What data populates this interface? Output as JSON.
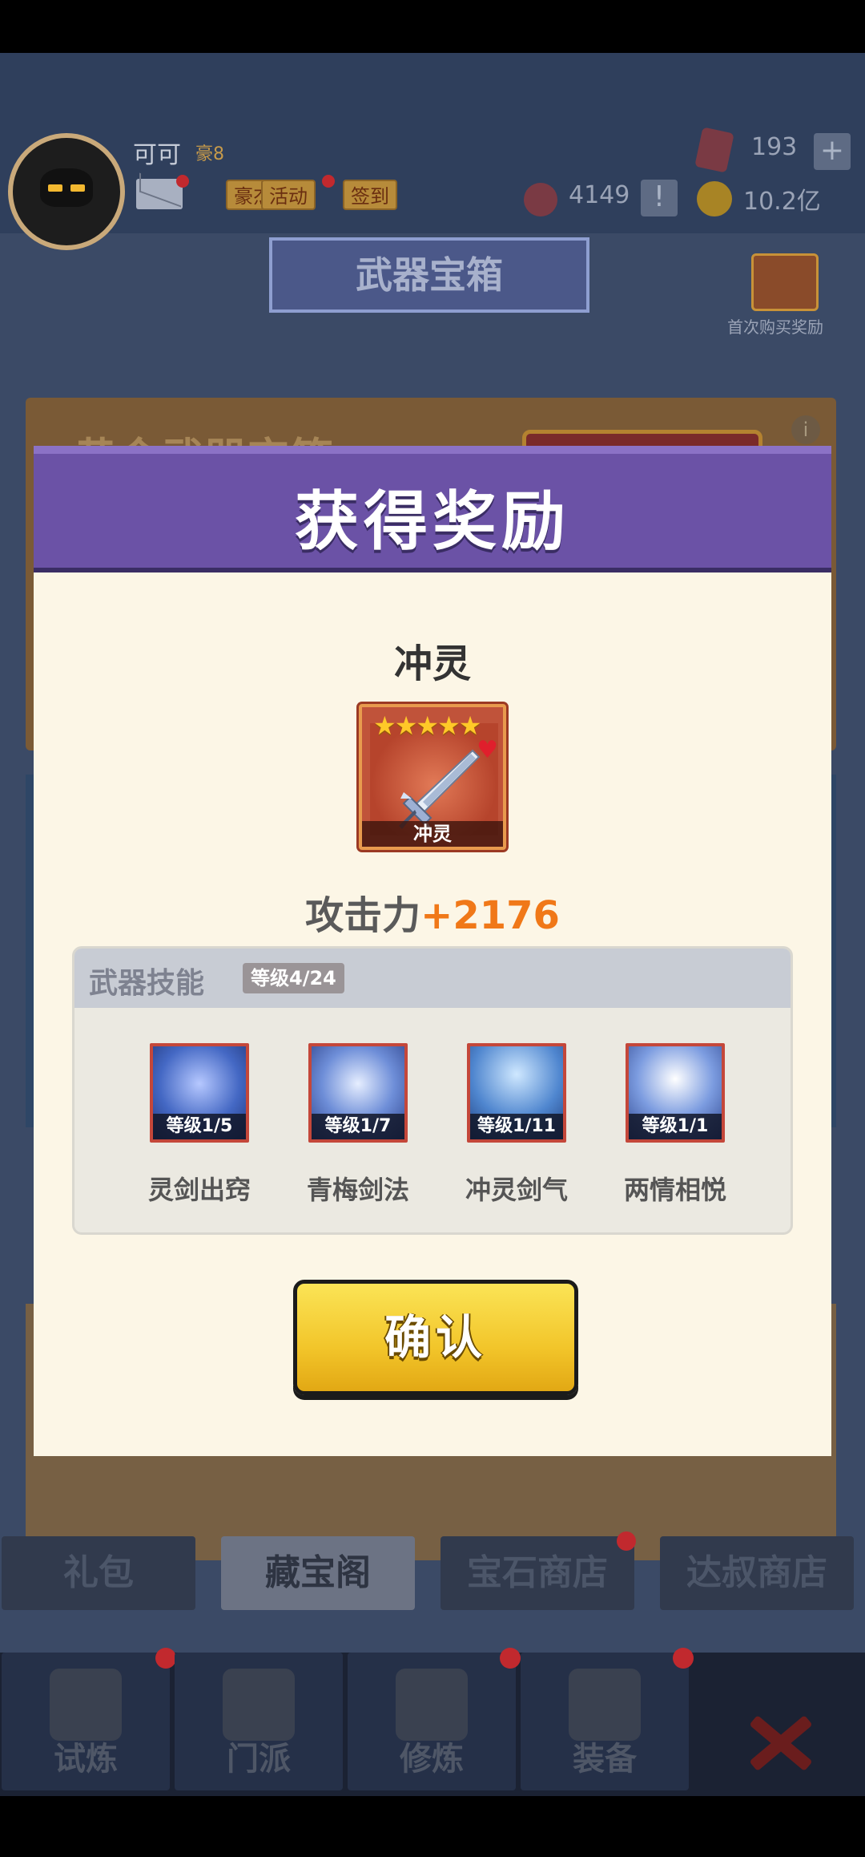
{
  "player": {
    "name": "可可",
    "vip": "豪8",
    "tags": [
      "豪杰",
      "活动",
      "签到"
    ]
  },
  "resources": {
    "gems": "193",
    "tokens": "4149",
    "gold": "10.2亿"
  },
  "page_title": "武器宝箱",
  "first_purchase_reward": "首次购买奖励",
  "gold_chest_title": "黄金武器宝箱",
  "shop_tabs": [
    "礼包",
    "藏宝阁",
    "宝石商店",
    "达叔商店"
  ],
  "bottom_nav": [
    "试炼",
    "门派",
    "修炼",
    "装备"
  ],
  "modal": {
    "title": "获得奖励",
    "weapon_name": "冲灵",
    "weapon_card_label": "冲灵",
    "stars": "★★★★★",
    "star_count": 5,
    "attack_label": "攻击力",
    "attack_value": "+2176",
    "skills_title": "武器技能",
    "skills_level": "等级4/24",
    "skills": [
      {
        "name": "灵剑出窍",
        "level": "等级1/5"
      },
      {
        "name": "青梅剑法",
        "level": "等级1/7"
      },
      {
        "name": "冲灵剑气",
        "level": "等级1/11"
      },
      {
        "name": "两情相悦",
        "level": "等级1/1"
      }
    ],
    "confirm_label": "确认"
  },
  "colors": {
    "header_purple": "#6b52a6",
    "attack_orange": "#f07818",
    "button_yellow": "#f2c52a"
  }
}
